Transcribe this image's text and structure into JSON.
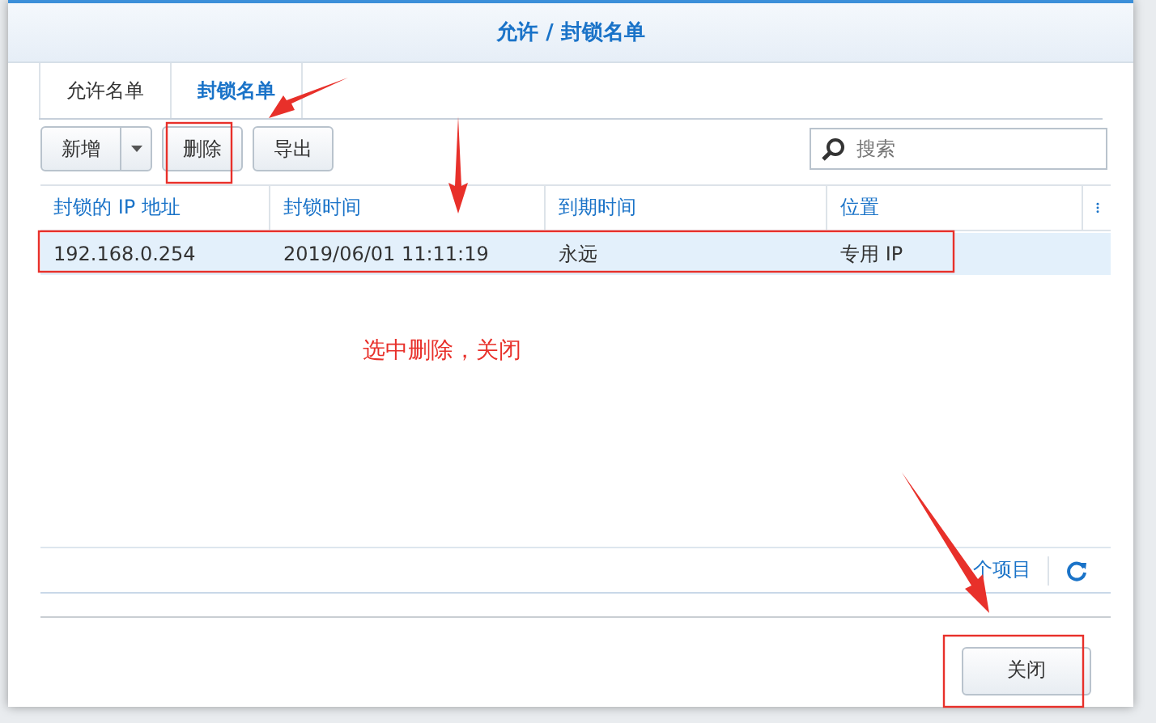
{
  "dialog": {
    "title": "允许 / 封锁名单"
  },
  "tabs": [
    {
      "label": "允许名单",
      "selected": false
    },
    {
      "label": "封锁名单",
      "selected": true
    }
  ],
  "toolbar": {
    "buttons": [
      {
        "label": "新增",
        "kind": "split"
      },
      {
        "label": "删除",
        "kind": "plain"
      },
      {
        "label": "导出",
        "kind": "plain"
      }
    ],
    "search": {
      "placeholder": "搜索"
    }
  },
  "table": {
    "columns": [
      "封锁的 IP 地址",
      "封锁时间",
      "到期时间",
      "位置"
    ],
    "rows": [
      {
        "cells": [
          "192.168.0.254",
          "2019/06/01 11:11:19",
          "永远",
          "专用 IP"
        ],
        "selected": true
      }
    ]
  },
  "footer": {
    "count": "个项目"
  },
  "buttons": [
    "关闭"
  ],
  "annotation": {
    "note": "选中删除，关闭"
  }
}
